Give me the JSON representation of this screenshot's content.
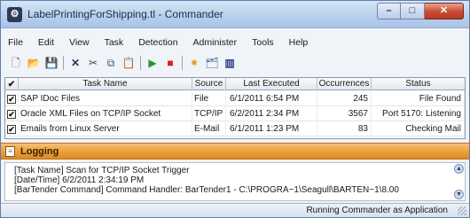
{
  "window": {
    "title": "LabelPrintingForShipping.tl - Commander",
    "controls": [
      "minimize-icon",
      "maximize-icon",
      "close-icon"
    ]
  },
  "menu": [
    "File",
    "Edit",
    "View",
    "Task",
    "Detection",
    "Administer",
    "Tools",
    "Help"
  ],
  "toolbar": [
    {
      "name": "new-document-icon",
      "glyph": "🗋"
    },
    {
      "name": "open-folder-icon",
      "glyph": "📂"
    },
    {
      "name": "save-disk-icon",
      "glyph": "💾"
    },
    {
      "name": "delete-x-icon",
      "glyph": "✕"
    },
    {
      "name": "cut-scissors-icon",
      "glyph": "✂"
    },
    {
      "name": "copy-icon",
      "glyph": "⧉"
    },
    {
      "name": "paste-clipboard-icon",
      "glyph": "📋"
    },
    {
      "name": "run-play-icon",
      "glyph": "▶"
    },
    {
      "name": "stop-icon",
      "glyph": "■"
    },
    {
      "name": "scan-sun-icon",
      "glyph": "✷"
    },
    {
      "name": "properties-icon",
      "glyph": "🗂"
    },
    {
      "name": "columns-icon",
      "glyph": "▥"
    }
  ],
  "table": {
    "check_header": "✔",
    "headers": [
      "Task Name",
      "Source",
      "Last Executed",
      "Occurrences",
      "Status"
    ],
    "rows": [
      {
        "checked": "✔",
        "name": "SAP IDoc Files",
        "source": "File",
        "last_executed": "6/1/2011 6:54 PM",
        "occurrences": "245",
        "status": "File Found"
      },
      {
        "checked": "✔",
        "name": "Oracle XML Files on TCP/IP Socket",
        "source": "TCP/IP",
        "last_executed": "6/2/2011 2:34 PM",
        "occurrences": "3567",
        "status": "Port 5170: Listening"
      },
      {
        "checked": "✔",
        "name": "Emails from Linux Server",
        "source": "E-Mail",
        "last_executed": "6/1/2011 1:23 PM",
        "occurrences": "83",
        "status": "Checking Mail"
      }
    ]
  },
  "logging": {
    "title": "Logging",
    "lines": [
      "[Task Name] Scan for TCP/IP Socket Trigger",
      "[Date/Time] 6/2/2011 2:34:19 PM",
      "[BarTender Command] Command Handler: BarTender1 - C:\\PROGRA~1\\Seagull\\BARTEN~1\\8.00"
    ]
  },
  "status_bar": {
    "text": "Running Commander as Application"
  }
}
